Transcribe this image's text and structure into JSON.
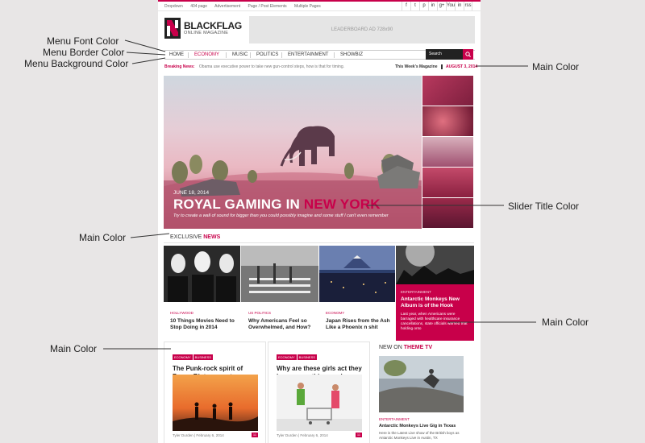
{
  "top_links": [
    "Dropdown",
    "404 page",
    "Advertisement",
    "Page / Post Elements",
    "Multiple Pages"
  ],
  "social": [
    "f",
    "t",
    "p",
    "in",
    "g+",
    "You",
    "in",
    "rss"
  ],
  "logo": {
    "name": "BLACKFLAG",
    "tagline": "ONLINE MAGAZINE"
  },
  "ad": {
    "label": "LEADERBOARD AD 728x90"
  },
  "menu": {
    "items": [
      {
        "label": "HOME"
      },
      {
        "label": "ECONOMY",
        "active": true
      },
      {
        "label": "MUSIC"
      },
      {
        "label": "POLITICS"
      },
      {
        "label": "ENTERTAINMENT"
      },
      {
        "label": "SHOWBIZ"
      }
    ],
    "search_label": "Search"
  },
  "breaking": {
    "label": "Breaking News:",
    "text": "Obama use executive power to take new gun-control steps, how is that for timing."
  },
  "magazine_label": "This Week's Magazine",
  "date_badge": "AUGUST 3, 2014",
  "hero": {
    "date": "JUNE 18, 2014",
    "title_main": "ROYAL GAMING IN",
    "title_accent": "NEW YORK",
    "subtitle": "Try to create a wall of sound for bigger than you could possibly imagine and some stuff I can't even remember"
  },
  "exclusive": {
    "prefix": "EXCLUSIVE",
    "accent": "NEWS"
  },
  "cards": [
    {
      "category": "HOLLYWOOD",
      "title": "10 Things Movies Need to Stop Doing in 2014"
    },
    {
      "category": "US POLITICS",
      "title": "Why Americans Feel so Overwhelmed, and How?"
    },
    {
      "category": "ECONOMY",
      "title": "Japan Rises from the Ash Like a Phoenix n shit"
    }
  ],
  "feature": {
    "category": "ENTERTAINMENT",
    "title": "Antarctic Monkeys New Album is of the Hook",
    "text": "Last year, when Americans were barraged with healthcare insurance cancellations, state officials warned that holding onto"
  },
  "bottom": [
    {
      "tags": [
        "ECONOMY",
        "BUSINESS"
      ],
      "title": "The Punk-rock spirit of Pussy Riot comes to America",
      "meta": "Tyler Durden | February 6, 2014",
      "comments": "11"
    },
    {
      "tags": [
        "ECONOMY",
        "BUSINESS"
      ],
      "title": "Why are these girls act they know something cool",
      "meta": "Tyler Durden | February 6, 2014",
      "comments": "11"
    }
  ],
  "theme_tv": {
    "prefix": "NEW ON",
    "accent": "THEME TV",
    "category": "ENTERTAINMENT",
    "title": "Antarctic Monkeys Live Gig in Texas",
    "text": "Here is the Latest Live show of the British boys as Antarctic Monkeys Live in Austin, TX"
  },
  "annotations": {
    "menu_font": "Menu Font Color",
    "menu_border": "Menu Border Color",
    "menu_bg": "Menu Background Color",
    "main_color_1": "Main Color",
    "slider_title": "Slider Title Color",
    "main_color_2": "Main Color",
    "main_color_3": "Main Color",
    "main_color_4": "Main Color"
  },
  "colors": {
    "accent": "#c8004a",
    "dark": "#222222",
    "background": "#e8e6e6"
  }
}
